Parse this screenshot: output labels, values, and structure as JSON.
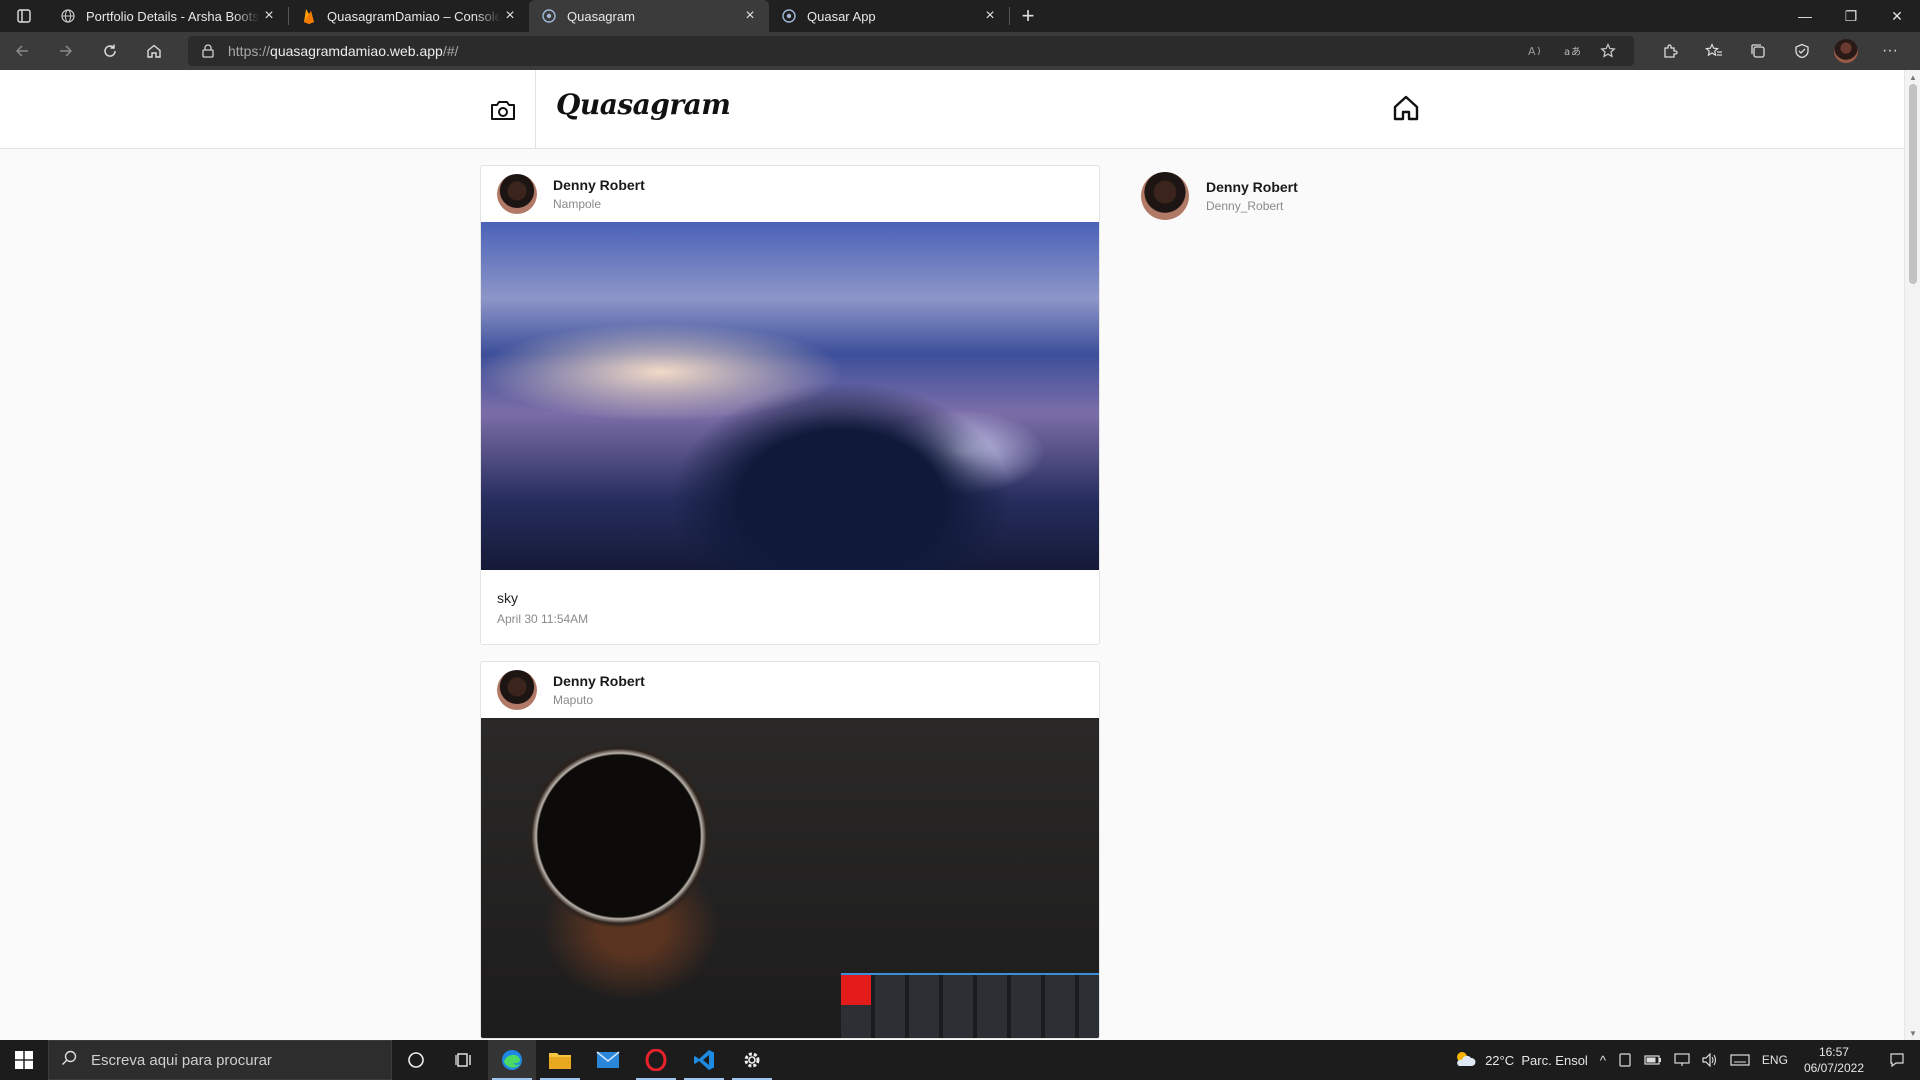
{
  "browser": {
    "tabs": [
      {
        "title": "Portfolio Details - Arsha Bootstrap",
        "favicon": "globe-icon",
        "active": false
      },
      {
        "title": "QuasagramDamiao – Console do Firebase",
        "favicon": "firebase-icon",
        "active": false
      },
      {
        "title": "Quasagram",
        "favicon": "quasar-icon",
        "active": true
      },
      {
        "title": "Quasar App",
        "favicon": "quasar-icon",
        "active": false
      }
    ],
    "new_tab_label": "+",
    "url_prefix": "https://",
    "url_host": "quasagramdamiao.web.app",
    "url_path": "/#/"
  },
  "app": {
    "logo": "Quasagram",
    "posts": [
      {
        "author": "Denny Robert",
        "location": "Nampole",
        "caption": "sky",
        "date": "April 30 11:54AM",
        "image": "night-mountain-landscape"
      },
      {
        "author": "Denny Robert",
        "location": "Maputo",
        "caption": "",
        "date": "",
        "image": "coffee-cup-keyboard"
      }
    ],
    "sidebar_user": {
      "name": "Denny Robert",
      "username": "Denny_Robert"
    }
  },
  "taskbar": {
    "search_placeholder": "Escreva aqui para procurar",
    "weather": "22°C  Parc. Ensol",
    "language": "ENG",
    "time": "16:57",
    "date": "06/07/2022"
  }
}
